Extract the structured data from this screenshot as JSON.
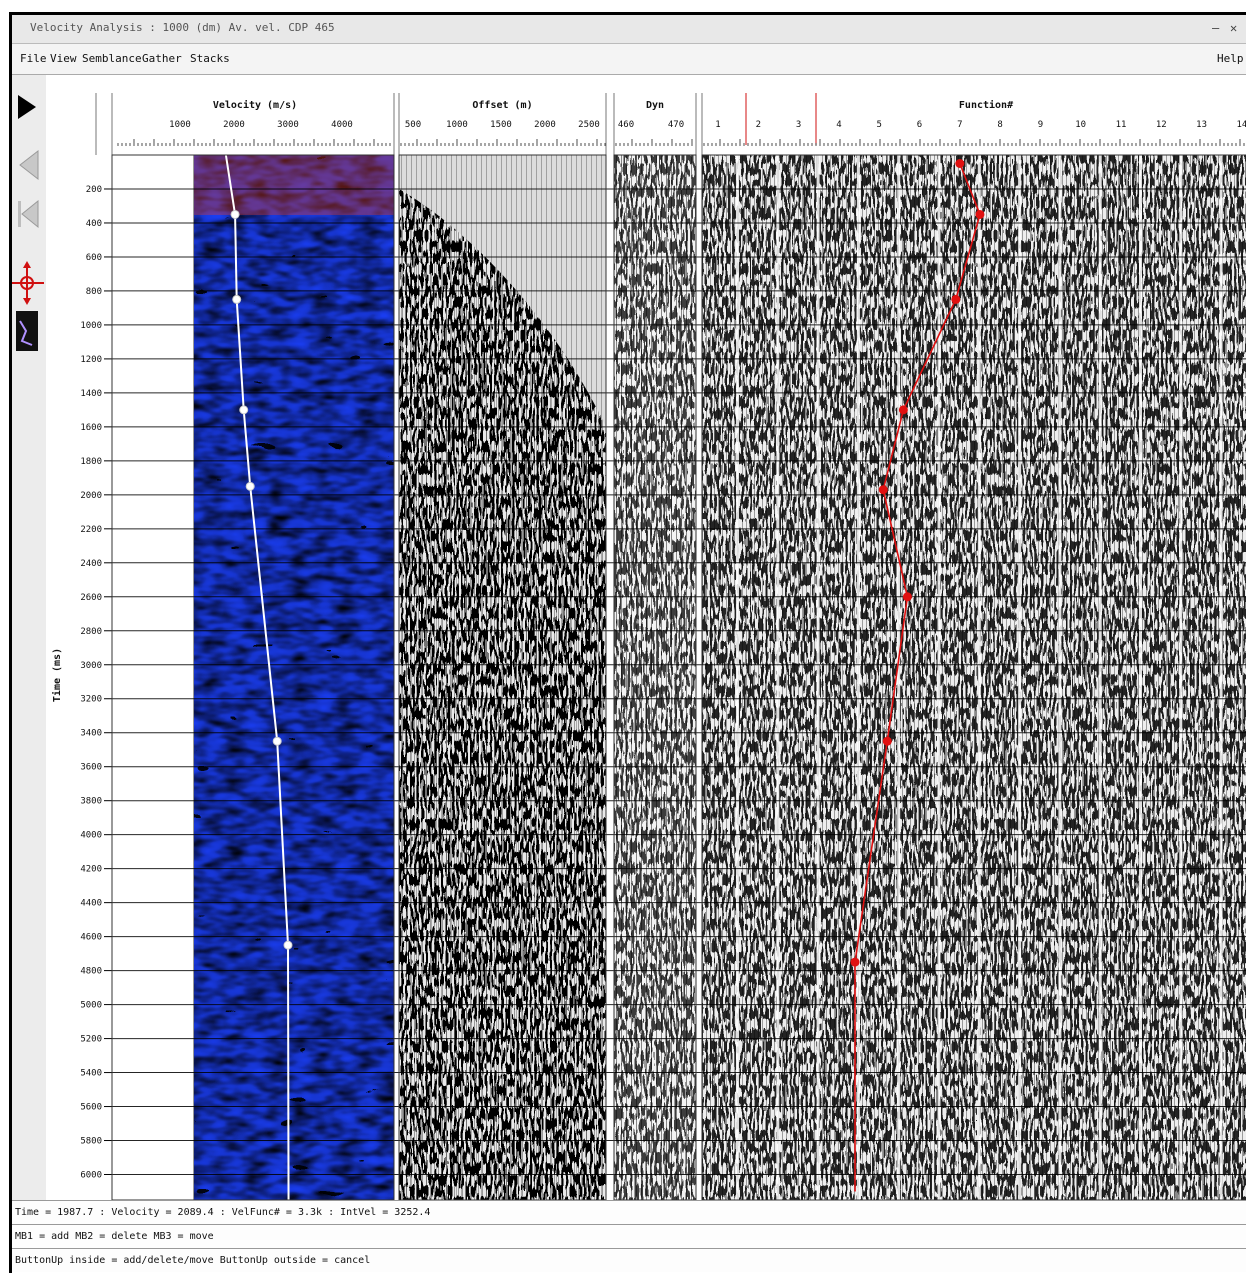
{
  "window": {
    "title": "Velocity Analysis : 1000 (dm) Av. vel. CDP 465",
    "minimize_glyph": "–",
    "close_glyph": "✕"
  },
  "menu": [
    "File",
    "View",
    "Semblance",
    "Gather",
    "Stacks"
  ],
  "menu_help": "Help",
  "toolbar": {
    "play_icon": "play-icon",
    "back_icon": "back-arrow-icon",
    "rewind_icon": "rewind-icon",
    "move_icon": "move-cross-icon",
    "function_icon": "function-tool-icon"
  },
  "panels": {
    "velocity": {
      "label": "Velocity (m/s)",
      "ticks": [
        "1000",
        "2000",
        "3000",
        "4000"
      ]
    },
    "offset": {
      "label": "Offset (m)",
      "ticks": [
        "500",
        "1000",
        "1500",
        "2000",
        "2500"
      ]
    },
    "dyn": {
      "label": "Dyn",
      "ticks": [
        "460",
        "470"
      ]
    },
    "function": {
      "label": "Function#",
      "ticks": [
        "1",
        "2",
        "3",
        "4",
        "5",
        "6",
        "7",
        "8",
        "9",
        "10",
        "11",
        "12",
        "13",
        "14"
      ]
    }
  },
  "time_axis": {
    "label": "Time (ms)",
    "ticks": [
      "200",
      "400",
      "600",
      "800",
      "1000",
      "1200",
      "1400",
      "1600",
      "1800",
      "2000",
      "2200",
      "2400",
      "2600",
      "2800",
      "3000",
      "3200",
      "3400",
      "3600",
      "3800",
      "4000",
      "4200",
      "4400",
      "4600",
      "4800",
      "5000",
      "5200",
      "5400",
      "5600",
      "5800",
      "6000"
    ],
    "min": 0,
    "max": 6150
  },
  "picks": {
    "semblance_velocity": [
      {
        "t": 350,
        "v": 2020
      },
      {
        "t": 850,
        "v": 2050
      },
      {
        "t": 1500,
        "v": 2180
      },
      {
        "t": 1950,
        "v": 2300
      },
      {
        "t": 3450,
        "v": 2800
      },
      {
        "t": 4650,
        "v": 3000
      }
    ],
    "function_number": [
      {
        "t": 50,
        "f": 7.0
      },
      {
        "t": 350,
        "f": 7.5
      },
      {
        "t": 850,
        "f": 6.9
      },
      {
        "t": 1500,
        "f": 5.6
      },
      {
        "t": 1970,
        "f": 5.1
      },
      {
        "t": 2600,
        "f": 5.7
      },
      {
        "t": 3450,
        "f": 5.2
      },
      {
        "t": 4750,
        "f": 4.4
      },
      {
        "t": 6100,
        "f": 4.4
      }
    ]
  },
  "colors": {
    "semblance_low": "#1a3df0",
    "semblance_mid": "#1fd9d0",
    "semblance_high": "#f23a1a",
    "pick_red": "#e01010",
    "pick_white": "#ffffff"
  },
  "status": {
    "readout": "Time = 1987.7 : Velocity = 2089.4 : VelFunc# = 3.3k : IntVel = 3252.4",
    "mouse_help": "MB1 = add  MB2 = delete  MB3 = move",
    "button_help": "ButtonUp inside = add/delete/move  ButtonUp outside = cancel"
  }
}
